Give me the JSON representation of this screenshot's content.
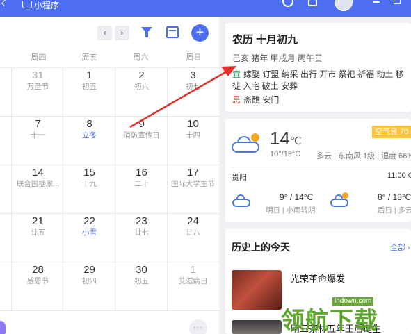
{
  "topbar": {
    "mini_program_label": "小程序",
    "icons": [
      "back-icon",
      "mini-program-icon",
      "search-icon",
      "bell-icon",
      "avatar",
      "minimize-icon",
      "maximize-icon"
    ]
  },
  "calendar": {
    "nav_prev": "‹",
    "nav_next": "›",
    "add_label": "+",
    "more_label": "···",
    "weekdays": [
      "周四",
      "周五",
      "周六",
      "周日"
    ],
    "rows": [
      [
        {
          "day": "31",
          "sub": "万圣节",
          "muted": true
        },
        {
          "day": "1",
          "sub": "初五"
        },
        {
          "day": "2",
          "sub": "初六"
        },
        {
          "day": "3",
          "sub": "初七"
        }
      ],
      [
        {
          "day": "7",
          "sub": "十一"
        },
        {
          "day": "8",
          "sub": "立冬",
          "highlight": true
        },
        {
          "day": "9",
          "sub": "消防宣传日"
        },
        {
          "day": "10",
          "sub": "十四"
        }
      ],
      [
        {
          "day": "14",
          "sub": "联合国糖尿..."
        },
        {
          "day": "15",
          "sub": "十九"
        },
        {
          "day": "16",
          "sub": "二十"
        },
        {
          "day": "17",
          "sub": "国际大学生节"
        }
      ],
      [
        {
          "day": "21",
          "sub": "廿五"
        },
        {
          "day": "22",
          "sub": "小雪",
          "highlight": true
        },
        {
          "day": "23",
          "sub": "廿七"
        },
        {
          "day": "24",
          "sub": "廿八"
        }
      ],
      [
        {
          "day": "28",
          "sub": "感恩节"
        },
        {
          "day": "29",
          "sub": "初四"
        },
        {
          "day": "30",
          "sub": "初五"
        },
        {
          "day": "1",
          "sub": "艾滋病日",
          "muted": true
        }
      ]
    ]
  },
  "lunar": {
    "title": "农历 十月初九",
    "ganzhi": "己亥 猪年 甲戌月 丙午日",
    "yi_label": "宜",
    "yi_text": "嫁娶 订盟 纳采 出行 开市 祭祀 祈福 动土 移徙 入宅 破土 安葬",
    "ji_label": "忌",
    "ji_text": "斋醮 安门"
  },
  "weather": {
    "temp": "14",
    "unit": "℃",
    "range": "10°/19°C",
    "detail": "多云 | 东南风 1级 | 湿度 66%",
    "aq": "空气良 70",
    "city": "贵阳",
    "time": "11:00 C",
    "forecast": [
      {
        "temp": "9° / 14°C",
        "desc": "明日 | 小雨转阴"
      },
      {
        "temp": "8° / 18°C",
        "desc": "后日 | 多云"
      }
    ]
  },
  "history": {
    "title": "历史上的今天",
    "all_label": "全部 ›",
    "items": [
      "光荣革命爆发",
      "晴三茶林五年王后诞生"
    ]
  },
  "watermark": {
    "url": "ihdown.com",
    "text": "领航下载"
  },
  "colors": {
    "accent": "#4e6ef2",
    "yi": "#2bb06a",
    "ji": "#e0493c",
    "arrow": "#e0302a",
    "aq": "#ffc53d"
  }
}
